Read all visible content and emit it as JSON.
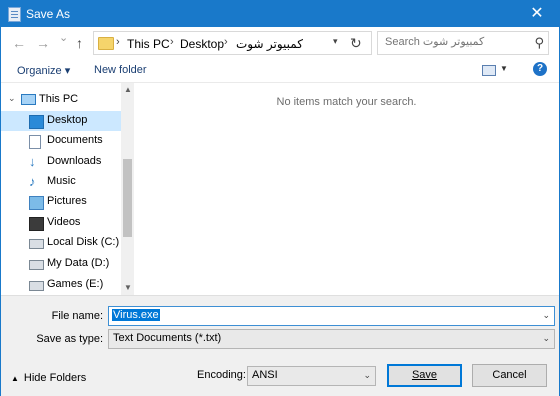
{
  "titlebar": {
    "title": "Save As",
    "close": "✕"
  },
  "nav": {
    "back": "←",
    "forward": "→",
    "recent": "⌄",
    "up": "↑",
    "breadcrumb": [
      "This PC",
      "Desktop",
      "كمبيوتر شوت"
    ],
    "crumb_sep": "›",
    "refresh": "↻",
    "search_placeholder": "Search كمبيوتر شوت"
  },
  "toolbar": {
    "organize": "Organize ▾",
    "new_folder": "New folder",
    "help": "?"
  },
  "sidebar": {
    "items": [
      {
        "label": "This PC",
        "icon": "computer-icon"
      },
      {
        "label": "Desktop",
        "icon": "desktop-icon",
        "selected": true
      },
      {
        "label": "Documents",
        "icon": "documents-icon"
      },
      {
        "label": "Downloads",
        "icon": "downloads-icon"
      },
      {
        "label": "Music",
        "icon": "music-icon"
      },
      {
        "label": "Pictures",
        "icon": "pictures-icon"
      },
      {
        "label": "Videos",
        "icon": "videos-icon"
      },
      {
        "label": "Local Disk (C:)",
        "icon": "disk-icon"
      },
      {
        "label": "My Data (D:)",
        "icon": "disk-icon"
      },
      {
        "label": "Games (E:)",
        "icon": "disk-icon"
      }
    ]
  },
  "content": {
    "empty_message": "No items match your search."
  },
  "form": {
    "filename_label": "File name:",
    "filename_value": "Virus.exe",
    "type_label": "Save as type:",
    "type_value": "Text Documents (*.txt)",
    "hide_folders": "Hide Folders",
    "encoding_label": "Encoding:",
    "encoding_value": "ANSI",
    "save": "Save",
    "cancel": "Cancel"
  },
  "colors": {
    "titlebar": "#1979ca",
    "selection": "#cce8ff",
    "accent": "#0078d7"
  }
}
